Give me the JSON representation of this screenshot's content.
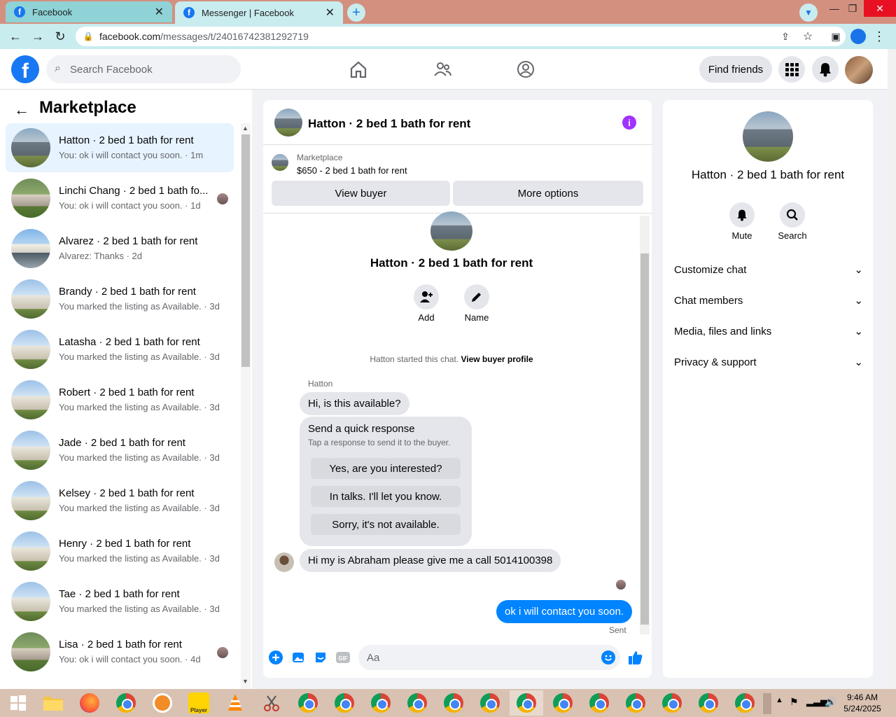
{
  "browser": {
    "tabs": [
      {
        "label": "Facebook",
        "icon": "facebook-icon"
      },
      {
        "label": "Messenger | Facebook",
        "icon": "facebook-icon"
      }
    ],
    "url_host": "facebook.com",
    "url_path": "/messages/t/24016742381292719"
  },
  "header": {
    "search_placeholder": "Search Facebook",
    "find_friends": "Find friends"
  },
  "sidebar": {
    "title": "Marketplace",
    "conversations": [
      {
        "name": "Hatton · 2 bed 1 bath for rent",
        "preview": "You: ok i will contact you soon. · 1m",
        "selected": true
      },
      {
        "name": "Linchi Chang · 2 bed 1 bath fo...",
        "preview": "You: ok i will contact you soon. · 1d"
      },
      {
        "name": "Alvarez · 2 bed 1 bath for rent",
        "preview": "Alvarez: Thanks · 2d"
      },
      {
        "name": "Brandy · 2 bed 1 bath for rent",
        "preview": "You marked the listing as Available. · 3d"
      },
      {
        "name": "Latasha · 2 bed 1 bath for rent",
        "preview": "You marked the listing as Available. · 3d"
      },
      {
        "name": "Robert · 2 bed 1 bath for rent",
        "preview": "You marked the listing as Available. · 3d"
      },
      {
        "name": "Jade · 2 bed 1 bath for rent",
        "preview": "You marked the listing as Available. · 3d"
      },
      {
        "name": "Kelsey · 2 bed 1 bath for rent",
        "preview": "You marked the listing as Available. · 3d"
      },
      {
        "name": "Henry · 2 bed 1 bath for rent",
        "preview": "You marked the listing as Available. · 3d"
      },
      {
        "name": "Tae · 2 bed 1 bath for rent",
        "preview": "You marked the listing as Available. · 3d"
      },
      {
        "name": "Lisa · 2 bed 1 bath for rent",
        "preview": "You: ok i will contact you soon. · 4d"
      }
    ]
  },
  "chat": {
    "title": "Hatton · 2 bed 1 bath for rent",
    "listing_source": "Marketplace",
    "listing_desc": "$650 - 2 bed 1 bath for rent",
    "view_buyer": "View buyer",
    "more_options": "More options",
    "intro_title": "Hatton · 2 bed 1 bath for rent",
    "add_label": "Add",
    "name_label": "Name",
    "started_text": "Hatton started this chat.",
    "started_link": "View buyer profile",
    "sender_name": "Hatton",
    "msg1": "Hi, is this available?",
    "quick_title": "Send a quick response",
    "quick_sub": "Tap a response to send it to the buyer.",
    "quick_options": [
      "Yes, are you interested?",
      "In talks. I'll let you know.",
      "Sorry, it's not available."
    ],
    "msg2": "Hi my is Abraham please give me a call 5014100398",
    "my_msg": "ok i will contact you soon.",
    "status": "Sent",
    "composer_placeholder": "Aa"
  },
  "details": {
    "title": "Hatton · 2 bed 1 bath for rent",
    "mute": "Mute",
    "search": "Search",
    "sections": [
      "Customize chat",
      "Chat members",
      "Media, files and links",
      "Privacy & support"
    ]
  },
  "taskbar": {
    "time": "9:46 AM",
    "date": "5/24/2025",
    "player_label": "Player"
  },
  "colors": {
    "brand": "#1877f2",
    "my_bubble": "#0084ff",
    "info_accent": "#a033ff"
  }
}
